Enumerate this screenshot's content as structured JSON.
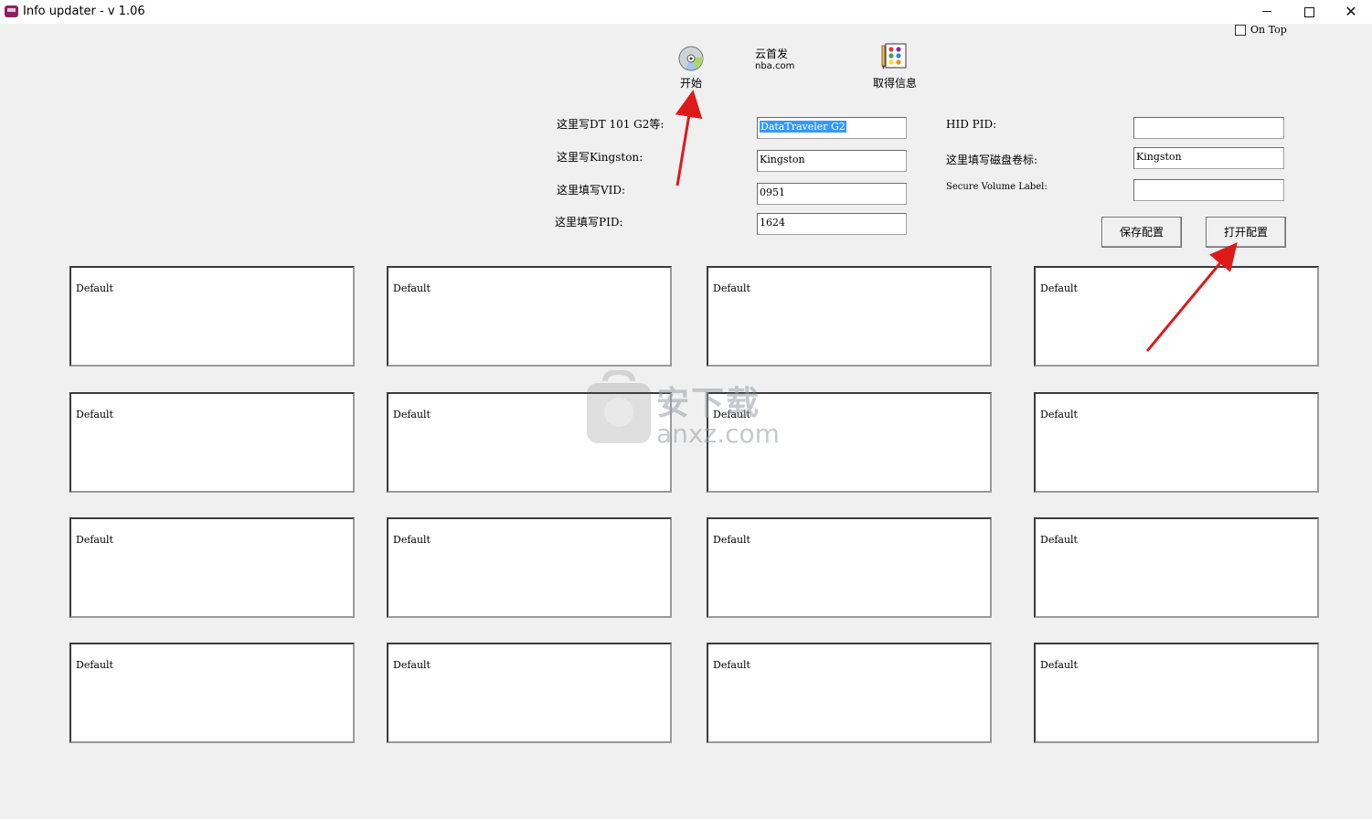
{
  "window": {
    "title": "Info updater - v 1.06",
    "close_glyph": "✕"
  },
  "on_top": {
    "label": "On Top",
    "checked": false
  },
  "toolbar": {
    "start_label": "开始",
    "get_info_label": "取得信息",
    "partial_text_line1": "云首发",
    "partial_text_line2": "nba.com"
  },
  "form": {
    "left": [
      {
        "label": "这里写DT 101 G2等:",
        "value": "DataTraveler G2"
      },
      {
        "label": "这里写Kingston:",
        "value": "Kingston"
      },
      {
        "label": "这里填写VID:",
        "value": "0951"
      },
      {
        "label": "这里填写PID:",
        "value": "1624"
      }
    ],
    "right": [
      {
        "label": "HID PID:",
        "value": ""
      },
      {
        "label": "这里填写磁盘卷标:",
        "value": "Kingston"
      },
      {
        "label": "Secure Volume Label:",
        "value": ""
      }
    ]
  },
  "buttons": {
    "save_config": "保存配置",
    "open_config": "打开配置"
  },
  "panels": [
    "Default",
    "Default",
    "Default",
    "Default",
    "Default",
    "Default",
    "Default",
    "Default",
    "Default",
    "Default",
    "Default",
    "Default",
    "Default",
    "Default",
    "Default",
    "Default"
  ],
  "watermark": {
    "line1": "安下载",
    "line2": "anxz.com",
    "logo_glyph": "安"
  },
  "colors": {
    "arrow": "#dd1a1a",
    "selection": "#3399ff"
  }
}
